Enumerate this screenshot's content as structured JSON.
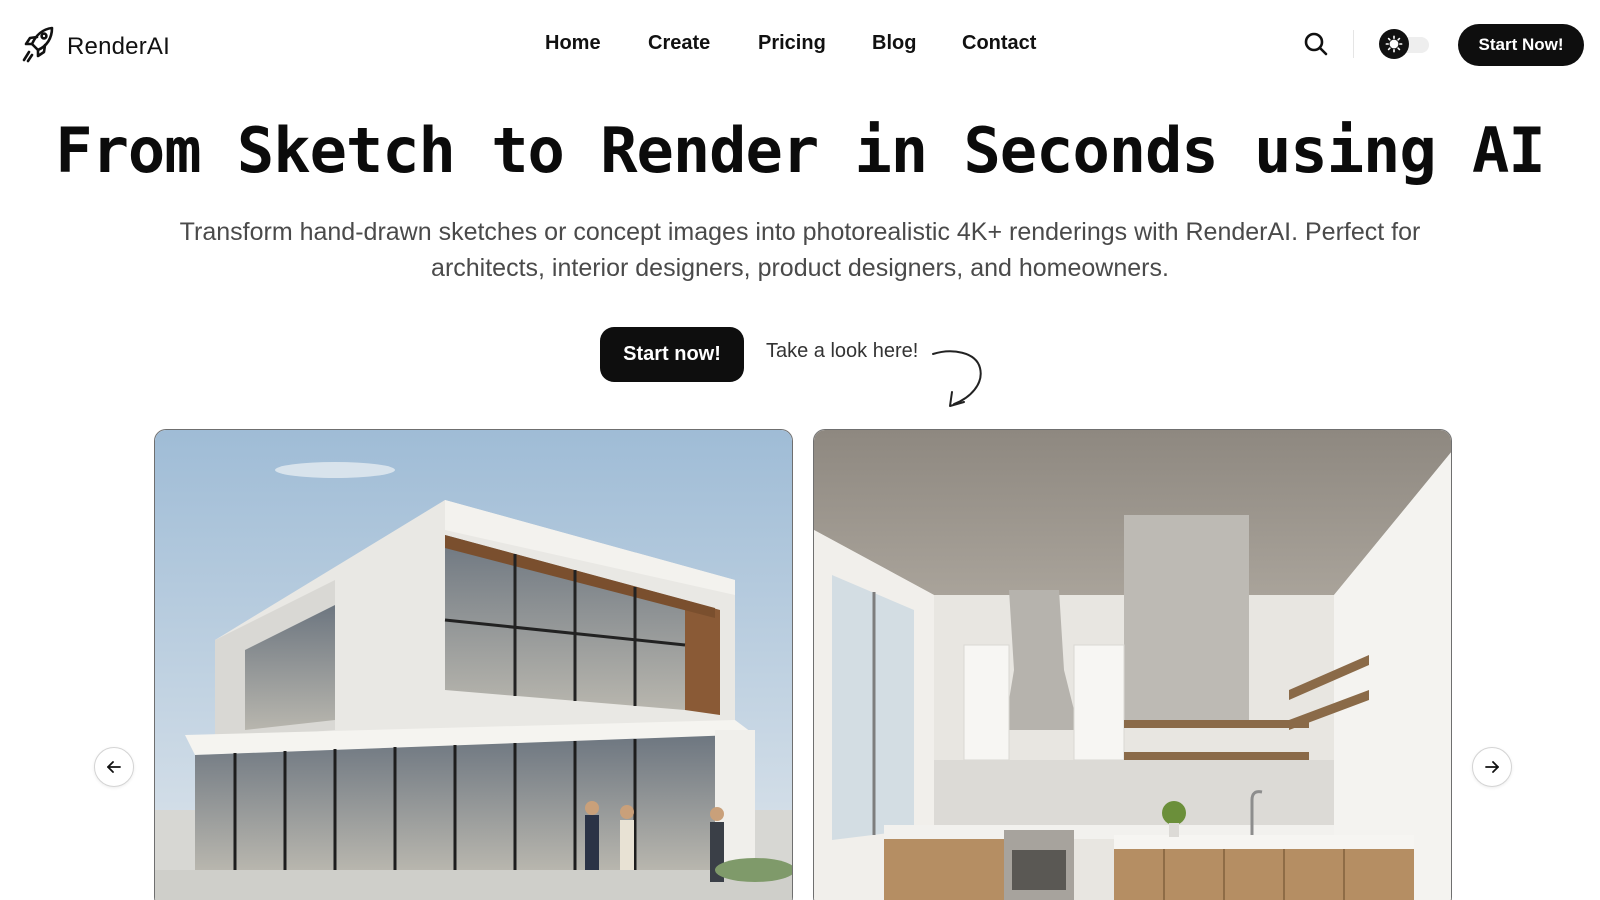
{
  "brand": {
    "name": "RenderAI",
    "icon": "rocket-icon"
  },
  "nav": {
    "items": [
      {
        "label": "Home"
      },
      {
        "label": "Create"
      },
      {
        "label": "Pricing"
      },
      {
        "label": "Blog"
      },
      {
        "label": "Contact"
      }
    ]
  },
  "header": {
    "search_icon": "search-icon",
    "theme_toggle": {
      "icon": "sun-icon",
      "state": "light"
    },
    "cta_label": "Start Now!"
  },
  "hero": {
    "title": "From Sketch to Render in Seconds using AI",
    "subtitle": "Transform hand-drawn sketches or concept images into photorealistic 4K+ renderings with RenderAI. Perfect for architects, interior designers, product designers, and homeowners.",
    "cta_label": "Start now!",
    "look_here": "Take a look here!"
  },
  "gallery": {
    "items": [
      {
        "subject": "modern-house-exterior"
      },
      {
        "subject": "modern-kitchen-interior"
      }
    ],
    "prev_icon": "arrow-left-icon",
    "next_icon": "arrow-right-icon"
  },
  "colors": {
    "primary": "#0e0e0e",
    "text": "#111111",
    "muted": "#4a4a4a",
    "background": "#ffffff"
  }
}
